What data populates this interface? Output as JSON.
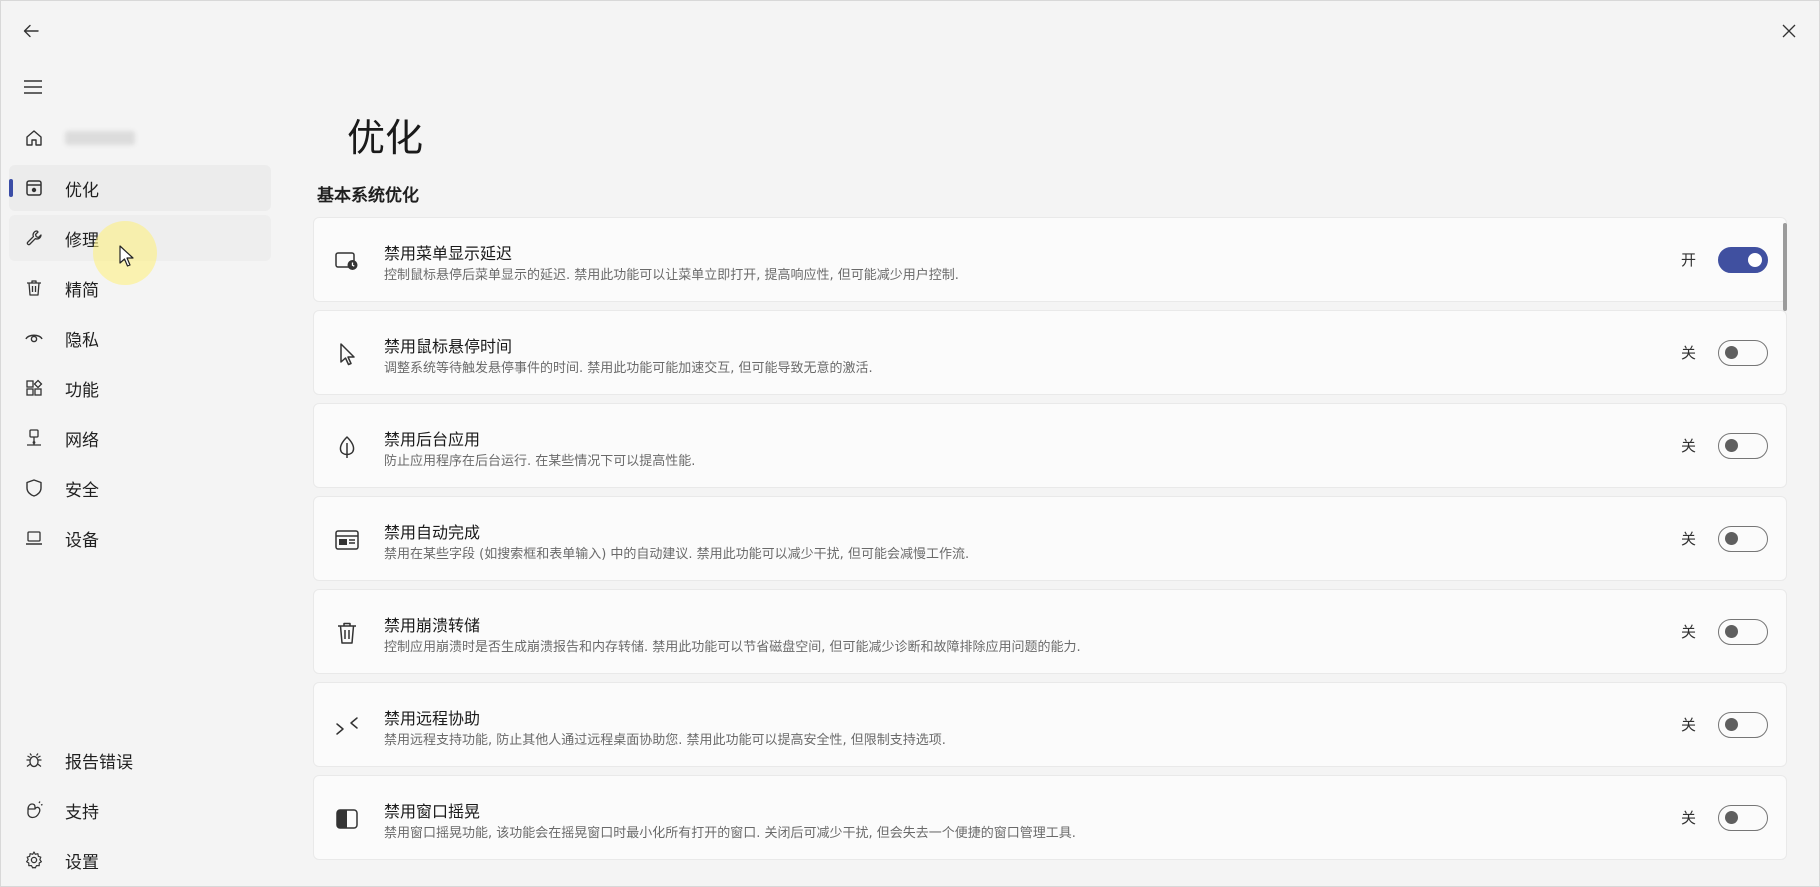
{
  "window": {
    "back_icon": "arrow-left-icon",
    "close_icon": "close-icon"
  },
  "sidebar": {
    "menu_icon": "hamburger-menu-icon",
    "items": [
      {
        "label": "",
        "icon": "home-icon",
        "blurred": true
      },
      {
        "label": "优化",
        "icon": "optimize-icon",
        "selected": true
      },
      {
        "label": "修理",
        "icon": "wrench-icon"
      },
      {
        "label": "精简",
        "icon": "trash-icon"
      },
      {
        "label": "隐私",
        "icon": "eye-icon"
      },
      {
        "label": "功能",
        "icon": "apps-grid-icon"
      },
      {
        "label": "网络",
        "icon": "network-icon"
      },
      {
        "label": "安全",
        "icon": "shield-icon"
      },
      {
        "label": "设备",
        "icon": "laptop-icon"
      }
    ],
    "bottom_items": [
      {
        "label": "报告错误",
        "icon": "bug-icon"
      },
      {
        "label": "支持",
        "icon": "support-icon"
      },
      {
        "label": "设置",
        "icon": "gear-icon"
      }
    ]
  },
  "main": {
    "page_title": "优化",
    "section_title": "基本系统优化",
    "on_label": "开",
    "off_label": "关",
    "settings": [
      {
        "title": "禁用菜单显示延迟",
        "description": "控制鼠标悬停后菜单显示的延迟. 禁用此功能可以让菜单立即打开, 提高响应性, 但可能减少用户控制.",
        "state": "开",
        "enabled": true,
        "icon": "menu-delay-icon"
      },
      {
        "title": "禁用鼠标悬停时间",
        "description": "调整系统等待触发悬停事件的时间. 禁用此功能可能加速交互, 但可能导致无意的激活.",
        "state": "关",
        "enabled": false,
        "icon": "cursor-icon"
      },
      {
        "title": "禁用后台应用",
        "description": "防止应用程序在后台运行. 在某些情况下可以提高性能.",
        "state": "关",
        "enabled": false,
        "icon": "leaf-icon"
      },
      {
        "title": "禁用自动完成",
        "description": "禁用在某些字段 (如搜索框和表单输入) 中的自动建议. 禁用此功能可以减少干扰, 但可能会减慢工作流.",
        "state": "关",
        "enabled": false,
        "icon": "form-icon"
      },
      {
        "title": "禁用崩溃转储",
        "description": "控制应用崩溃时是否生成崩溃报告和内存转储. 禁用此功能可以节省磁盘空间, 但可能减少诊断和故障排除应用问题的能力.",
        "state": "关",
        "enabled": false,
        "icon": "trash-icon"
      },
      {
        "title": "禁用远程协助",
        "description": "禁用远程支持功能, 防止其他人通过远程桌面协助您. 禁用此功能可以提高安全性, 但限制支持选项.",
        "state": "关",
        "enabled": false,
        "icon": "remote-assist-icon"
      },
      {
        "title": "禁用窗口摇晃",
        "description": "禁用窗口摇晃功能, 该功能会在摇晃窗口时最小化所有打开的窗口. 关闭后可减少干扰, 但会失去一个便捷的窗口管理工具.",
        "state": "关",
        "enabled": false,
        "icon": "window-shake-icon"
      }
    ]
  },
  "colors": {
    "accent": "#4050a0",
    "background": "#f4f4f4",
    "card": "#fbfbfb"
  }
}
